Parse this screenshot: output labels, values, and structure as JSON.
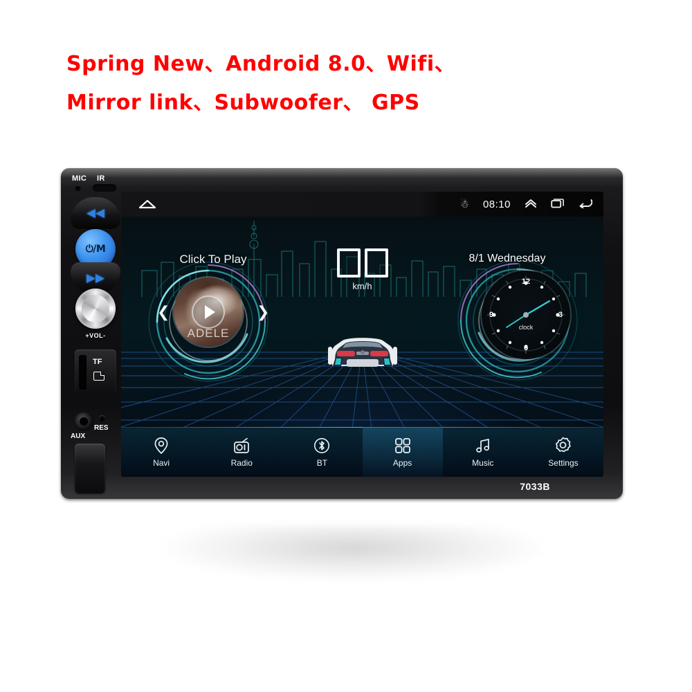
{
  "headline": {
    "line1": "Spring New、Android 8.0、Wifi、",
    "line2": "Mirror link、Subwoofer、 GPS"
  },
  "device": {
    "model_label": "7033B",
    "mic_label": "MIC",
    "ir_label": "IR",
    "power_button_label": "⏻/M",
    "prev_button_label": "◀◀",
    "next_button_label": "▶▶",
    "volume_label": "+VOL-",
    "tf_label": "TF",
    "aux_label": "AUX",
    "reset_label": "RES",
    "accent_blue": "#3d93ef"
  },
  "screen": {
    "statusbar": {
      "home_icon": "home-icon",
      "bluetooth_icon": "bluetooth-icon",
      "time": "08:10",
      "expand_icon": "chevron-up-icon",
      "recents_icon": "recents-icon",
      "back_icon": "back-icon"
    },
    "widgets": {
      "music_title": "Click To Play",
      "album_artist": "ADELE",
      "prev_icon": "chevron-left-icon",
      "next_icon": "chevron-right-icon",
      "play_icon": "play-icon",
      "speed_value": "",
      "speed_unit": "km/h",
      "date": "8/1  Wednesday",
      "clock_label": "clock",
      "clock_numerals": [
        "12",
        "3",
        "6",
        "9"
      ]
    },
    "navbar": [
      {
        "label": "Navi",
        "icon": "location-pin-icon",
        "active": false
      },
      {
        "label": "Radio",
        "icon": "radio-icon",
        "active": false
      },
      {
        "label": "BT",
        "icon": "bluetooth-circle-icon",
        "active": false
      },
      {
        "label": "Apps",
        "icon": "grid-apps-icon",
        "active": true
      },
      {
        "label": "Music",
        "icon": "music-note-icon",
        "active": false
      },
      {
        "label": "Settings",
        "icon": "gear-icon",
        "active": false
      }
    ]
  },
  "colors": {
    "headline_red": "#ff0000",
    "screen_teal": "#2fd3d8",
    "grid_blue": "#2a5fa8"
  }
}
